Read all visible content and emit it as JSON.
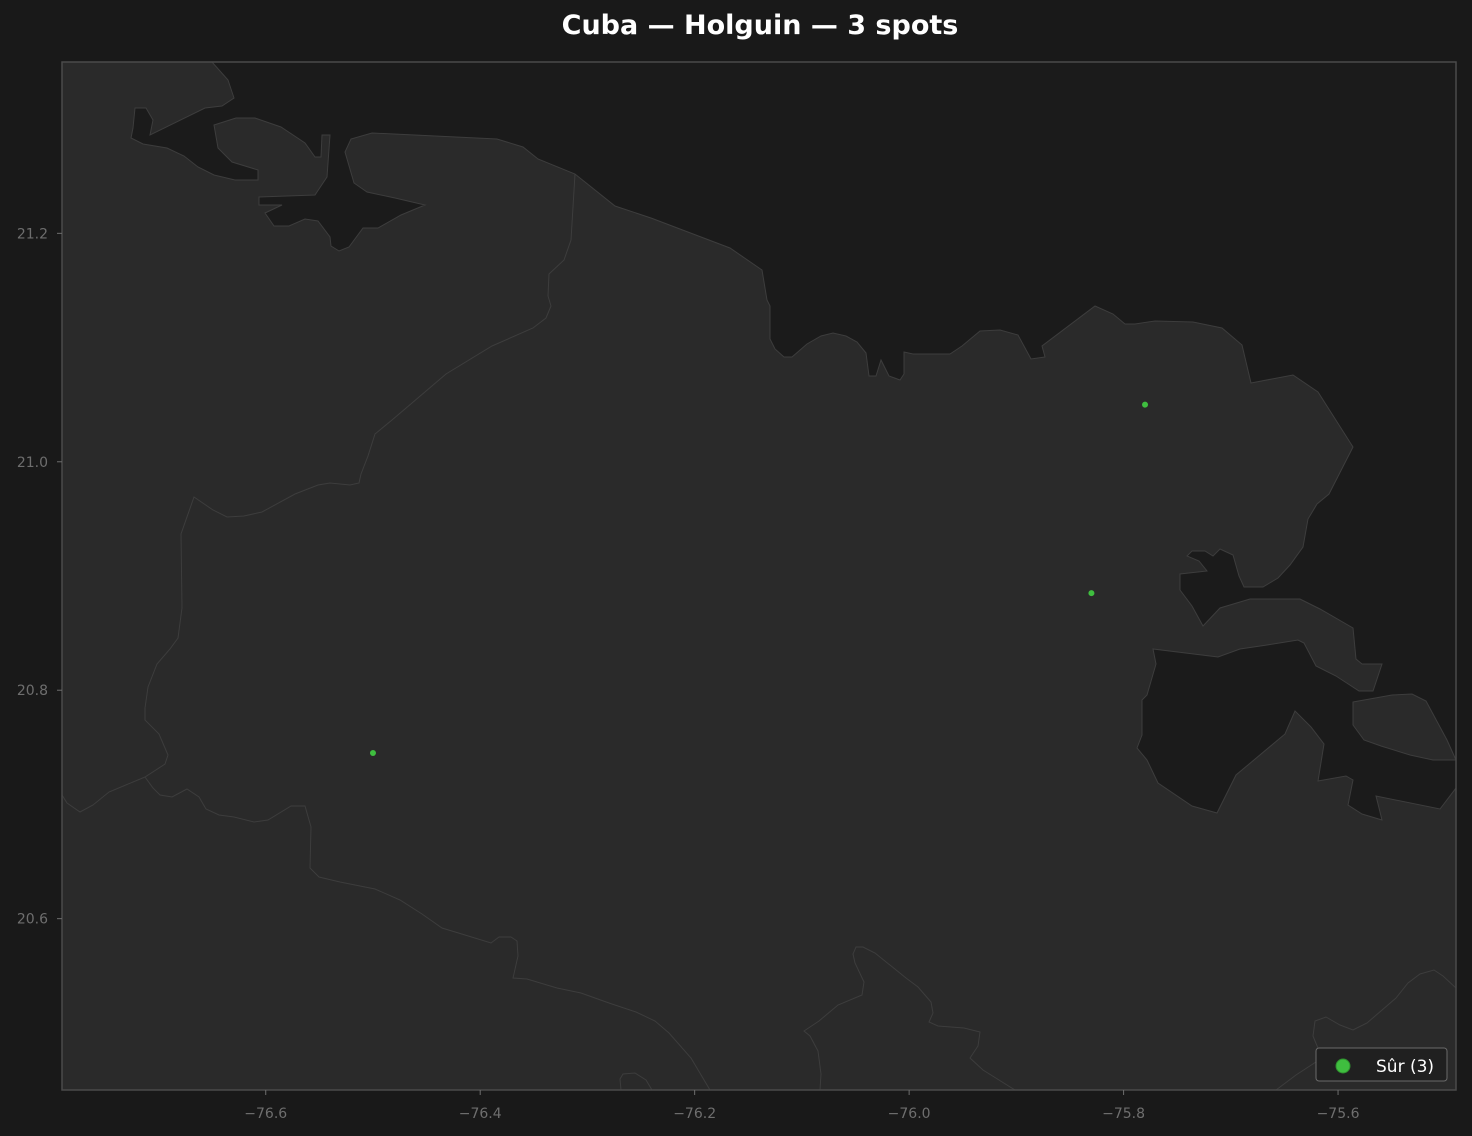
{
  "title": "Cuba — Holguin — 3 spots",
  "colors": {
    "background": "#191919",
    "sea": "#1b1b1b",
    "land": "#2a2a2a",
    "border": "#3d3d3d",
    "spot": "#3fbe3f",
    "tick": "#6e6e6e"
  },
  "chart_data": {
    "type": "scatter",
    "xlim": [
      -76.79,
      -75.49
    ],
    "ylim": [
      20.45,
      21.35
    ],
    "x_ticks": [
      "−76.6",
      "−76.4",
      "−76.2",
      "−76.0",
      "−75.8",
      "−75.6"
    ],
    "y_ticks": [
      "20.6",
      "20.8",
      "21.0",
      "21.2"
    ],
    "grid": false,
    "legend_position": "bottom-right",
    "series": [
      {
        "name": "Sûr (3)",
        "color": "#3fbe3f",
        "points": [
          {
            "lon": -75.78,
            "lat": 21.05
          },
          {
            "lon": -75.83,
            "lat": 20.885
          },
          {
            "lon": -76.5,
            "lat": 20.745
          }
        ]
      }
    ]
  }
}
